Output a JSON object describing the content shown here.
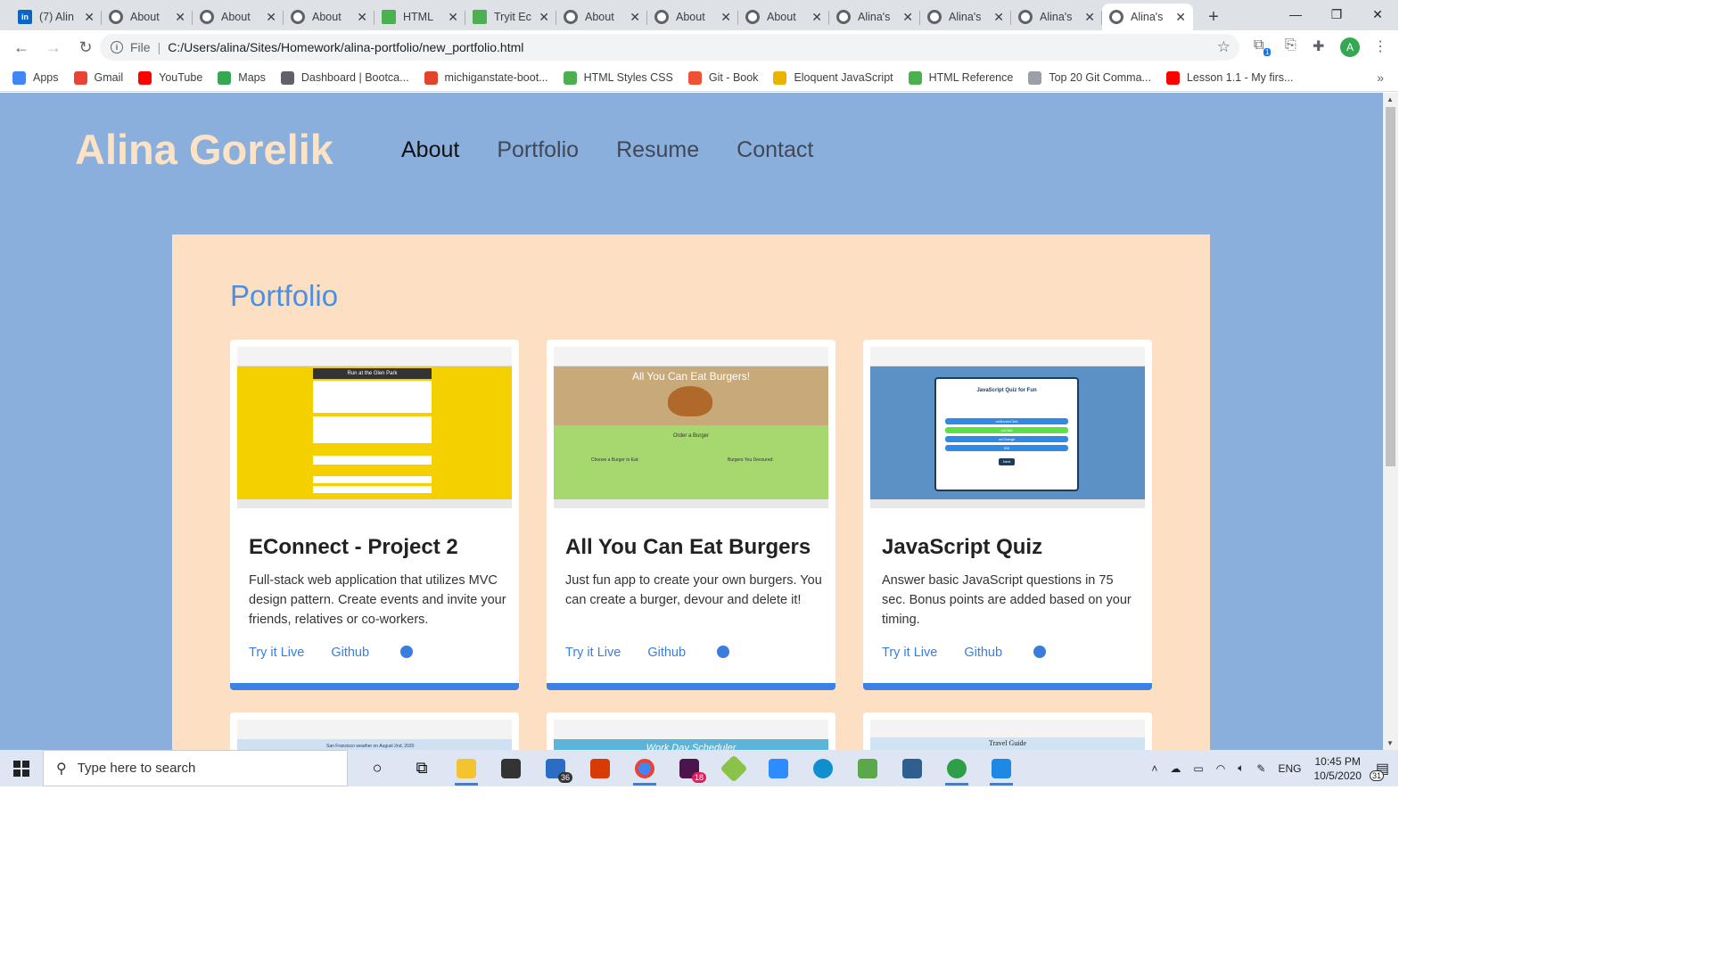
{
  "browser": {
    "tabs": [
      {
        "title": "(7) Alin",
        "favicon": "linkedin-icon",
        "active": false
      },
      {
        "title": "About",
        "favicon": "globe-icon",
        "active": false
      },
      {
        "title": "About",
        "favicon": "globe-icon",
        "active": false
      },
      {
        "title": "About",
        "favicon": "globe-icon",
        "active": false
      },
      {
        "title": "HTML",
        "favicon": "w3schools-icon",
        "active": false
      },
      {
        "title": "Tryit Ec",
        "favicon": "w3schools-icon",
        "active": false
      },
      {
        "title": "About",
        "favicon": "globe-icon",
        "active": false
      },
      {
        "title": "About",
        "favicon": "globe-icon",
        "active": false
      },
      {
        "title": "About",
        "favicon": "globe-icon",
        "active": false
      },
      {
        "title": "Alina's",
        "favicon": "globe-icon",
        "active": false
      },
      {
        "title": "Alina's",
        "favicon": "globe-icon",
        "active": false
      },
      {
        "title": "Alina's",
        "favicon": "globe-icon",
        "active": false
      },
      {
        "title": "Alina's",
        "favicon": "globe-icon",
        "active": true
      }
    ],
    "address": {
      "scheme_label": "File",
      "url": "C:/Users/alina/Sites/Homework/alina-portfolio/new_portfolio.html"
    },
    "profile_initial": "A",
    "extension_badge": "1",
    "bookmarks": [
      {
        "label": "Apps",
        "icon": "apps-grid-icon",
        "color": "#4285f4"
      },
      {
        "label": "Gmail",
        "icon": "gmail-icon",
        "color": "#ea4335"
      },
      {
        "label": "YouTube",
        "icon": "youtube-icon",
        "color": "#ff0000"
      },
      {
        "label": "Maps",
        "icon": "maps-icon",
        "color": "#34a853"
      },
      {
        "label": "Dashboard | Bootca...",
        "icon": "globe-icon",
        "color": "#5f6368"
      },
      {
        "label": "michiganstate-boot...",
        "icon": "gitlab-icon",
        "color": "#e24329"
      },
      {
        "label": "HTML Styles CSS",
        "icon": "w3schools-icon",
        "color": "#4caf50"
      },
      {
        "label": "Git - Book",
        "icon": "git-icon",
        "color": "#f05033"
      },
      {
        "label": "Eloquent JavaScript",
        "icon": "ejs-icon",
        "color": "#e8b400"
      },
      {
        "label": "HTML Reference",
        "icon": "w3schools-icon",
        "color": "#4caf50"
      },
      {
        "label": "Top 20 Git Comma...",
        "icon": "globe-icon",
        "color": "#9aa0a6"
      },
      {
        "label": "Lesson 1.1 - My firs...",
        "icon": "youtube-icon",
        "color": "#ff0000"
      }
    ]
  },
  "site": {
    "brand": "Alina Gorelik",
    "nav": [
      {
        "label": "About",
        "active": true
      },
      {
        "label": "Portfolio",
        "active": false
      },
      {
        "label": "Resume",
        "active": false
      },
      {
        "label": "Contact",
        "active": false
      }
    ],
    "section_title": "Portfolio",
    "projects": [
      {
        "title": "EConnect - Project 2",
        "description": "Full-stack web application that utilizes MVC design pattern. Create events and invite your friends, relatives or co-workers.",
        "live_label": "Try it Live",
        "github_label": "Github",
        "screenshot_heading": "Run at the Glen Park",
        "screenshot_bg": "#f5d000"
      },
      {
        "title": "All You Can Eat Burgers",
        "description": "Just fun app to create your own burgers. You can create a burger, devour and delete it!",
        "live_label": "Try it Live",
        "github_label": "Github",
        "screenshot_heading": "All You Can Eat Burgers!",
        "screenshot_subheading": "Order a Burger",
        "screenshot_col1": "Choose a Burger to Eat:",
        "screenshot_col2": "Burgers You Devoured:",
        "screenshot_bg": "#a7d76f"
      },
      {
        "title": "JavaScript Quiz",
        "description": "Answer basic JavaScript questions in 75 sec. Bonus points are added based on your timing.",
        "live_label": "Try it Live",
        "github_label": "Github",
        "screenshot_heading": "JavaScript Quiz for Fun",
        "screenshot_options": [
          "onMouseClick",
          "onClick",
          "onChange",
          "IDK"
        ],
        "screenshot_button": "Next",
        "screenshot_bg": "#5b91c4"
      }
    ],
    "more_projects": [
      {
        "screenshot_heading": "San Francisco weather on August 2nd, 2020"
      },
      {
        "screenshot_heading": "Work Day Scheduler"
      },
      {
        "screenshot_heading": "Travel Guide"
      }
    ]
  },
  "taskbar": {
    "search_placeholder": "Type here to search",
    "mail_badge": "36",
    "slack_badge": "18",
    "language": "ENG",
    "time": "10:45 PM",
    "date": "10/5/2020",
    "notifications": "31"
  }
}
